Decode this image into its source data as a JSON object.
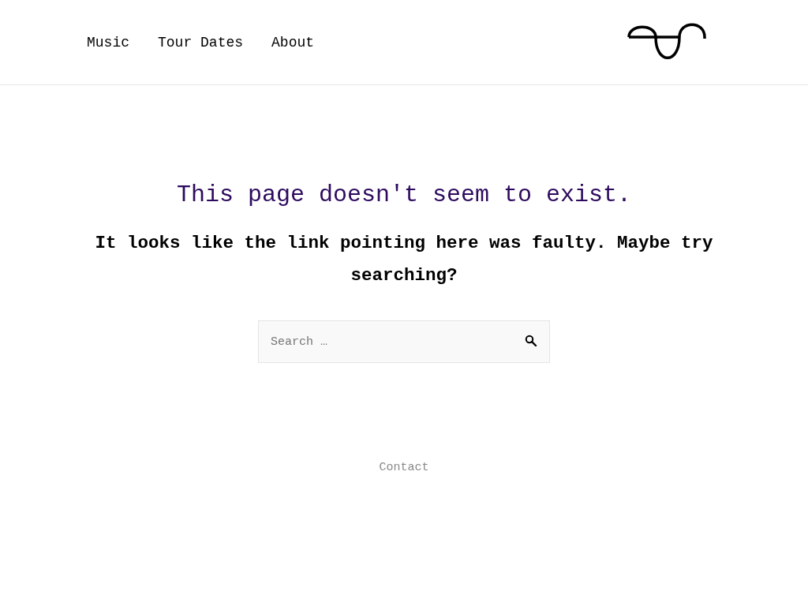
{
  "nav": {
    "items": [
      "Music",
      "Tour Dates",
      "About"
    ]
  },
  "error": {
    "title": "This page doesn't seem to exist.",
    "message": "It looks like the link pointing here was faulty. Maybe try searching?"
  },
  "search": {
    "placeholder": "Search …"
  },
  "footer": {
    "links": [
      "Contact"
    ]
  }
}
